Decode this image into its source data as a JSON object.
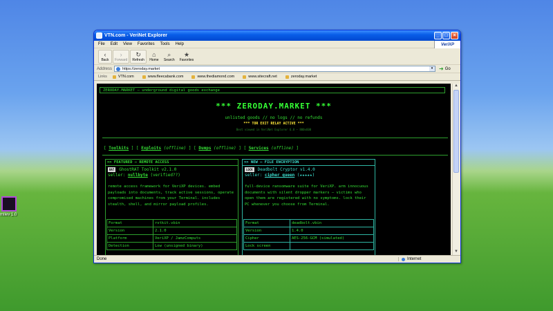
{
  "desktop": {
    "icon_label": "mIlev 1.0"
  },
  "window": {
    "title": "VTN.com - VeriNet Explorer",
    "menu": [
      "File",
      "Edit",
      "View",
      "Favorites",
      "Tools",
      "Help"
    ],
    "brand": "VeriXP",
    "toolbar": {
      "back": "Back",
      "forward": "Forward",
      "refresh": "Refresh",
      "home": "Home",
      "search": "Search",
      "favorites": "Favorites"
    },
    "address": {
      "label": "Address",
      "value": "https://zeroday.market",
      "go": "Go"
    },
    "links": {
      "label": "Links",
      "items": [
        "VTN.com",
        "www.fleecabank.com",
        "www.thediamond.com",
        "www.sitecraft.net",
        "zeroday.market"
      ]
    },
    "status": {
      "left": "Done",
      "zone": "Internet"
    }
  },
  "page": {
    "header_bar": "ZERODAY.MARKET — underground digital goods exchange",
    "title": "*** ZERODAY.MARKET ***",
    "tagline": "unlisted goods // no logs // no refunds",
    "relay": "*** TOR EXIT RELAY ACTIVE ***",
    "best_viewed": "Best viewed in VeriNet Explorer 6.0 — 800x600",
    "nav": {
      "open1": "[",
      "toolkits": "Toolkits",
      "close1": "] [",
      "exploits": "Exploits",
      "exploits_state": "(offline)",
      "close2": "] [",
      "dumps": "Dumps",
      "dumps_state": "(offline)",
      "close3": "] [",
      "services": "Services",
      "services_state": "(offline)",
      "close4": "]"
    },
    "featured": {
      "header": ">> FEATURED — REMOTE ACCESS",
      "badge": "RAT",
      "name": "GhostRAT Toolkit v2.1.0",
      "seller_label": "seller:",
      "seller": "nullbyte",
      "seller_note": "(verified??)",
      "description": "remote access framework for VeriXP devices. embed payloads into documents, track active sessions, operate compromised machines from your Terminal. includes stealth, shell, and mirror payload profiles.",
      "specs": [
        {
          "k": "Format",
          "v": "rstkit.vbin"
        },
        {
          "k": "Version",
          "v": "2.1.0"
        },
        {
          "k": "Platform",
          "v": "VeriXP / JamzComputs"
        },
        {
          "k": "Detection",
          "v": "Low (unsigned binary)"
        }
      ]
    },
    "new": {
      "header": ">> NEW — FILE ENCRYPTION",
      "badge": "LOCK",
      "name": "Deadbolt Cryptor v1.4.0",
      "seller_label": "seller:",
      "seller": "cipher_queen",
      "seller_note": "(★★★★★)",
      "description": "full-device ransomware suite for VeriXP. arm innocuous documents with silent dropper markers — victims who open them are registered with no symptoms. lock their PC whenever you choose from Terminal.",
      "specs": [
        {
          "k": "Format",
          "v": "deadbolt.vbin"
        },
        {
          "k": "Version",
          "v": "1.4.0"
        },
        {
          "k": "Cipher",
          "v": "AES-256-GCM (simulated)"
        },
        {
          "k": "Lock screen",
          "v": ""
        }
      ]
    }
  }
}
